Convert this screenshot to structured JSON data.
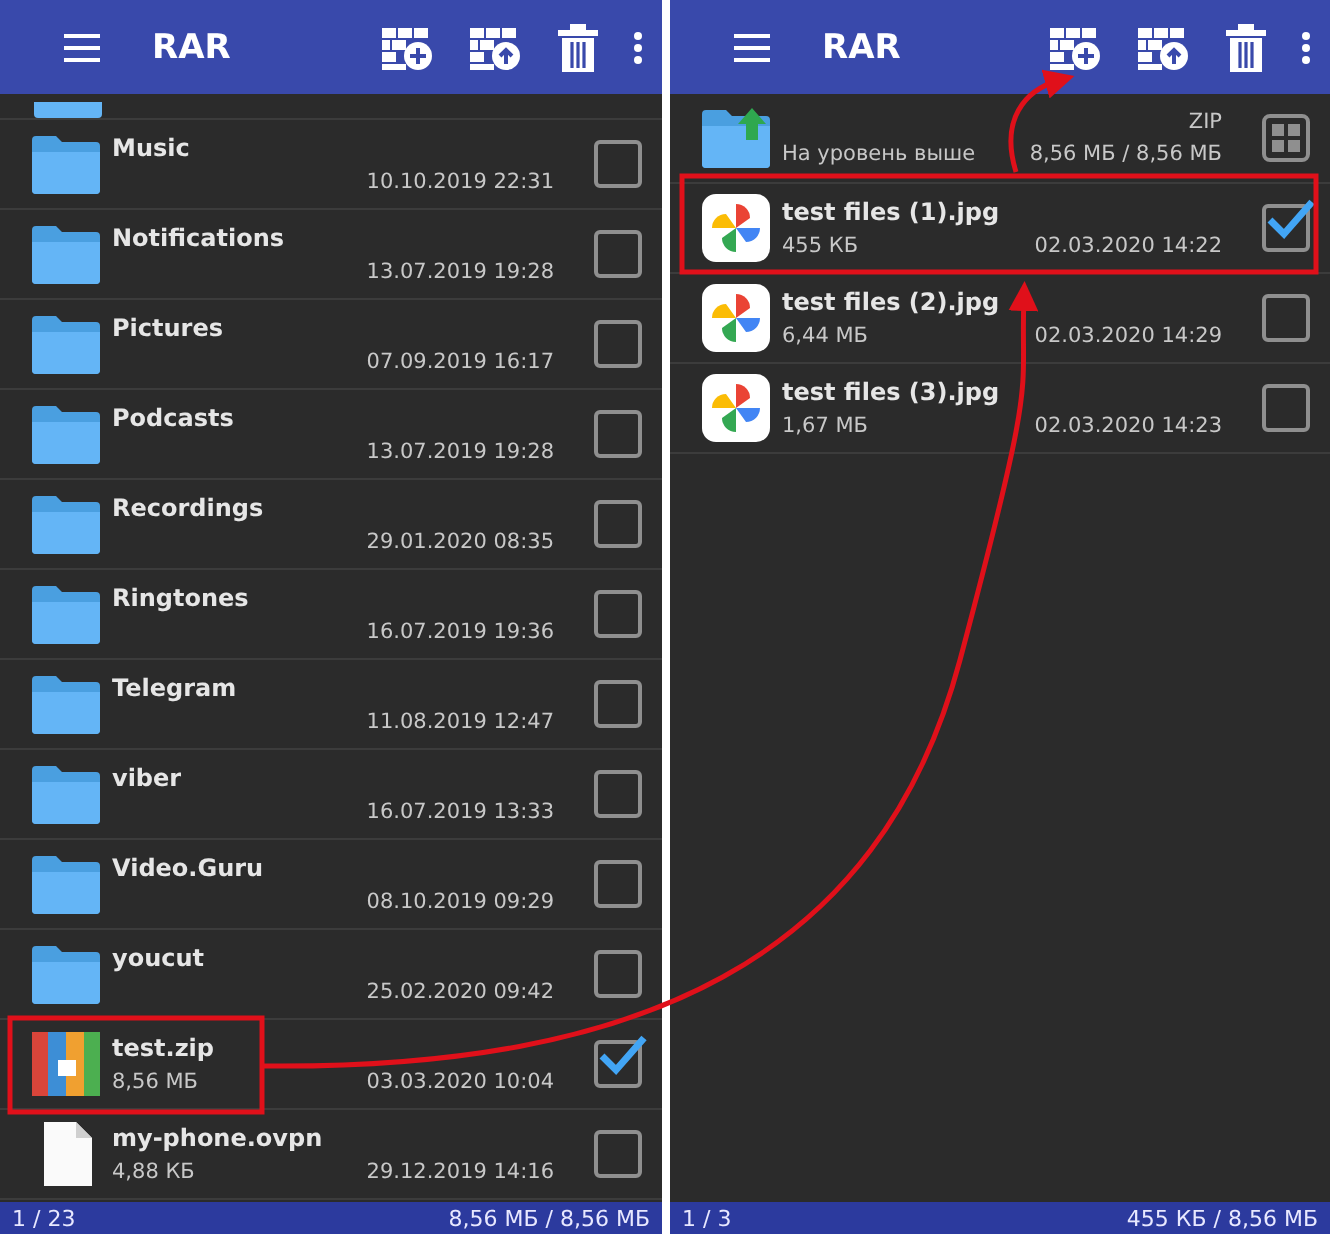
{
  "panels": [
    {
      "toolbar": {
        "title": "RAR"
      },
      "partial_row": true,
      "files": [
        {
          "kind": "folder",
          "name": "Music",
          "date": "10.10.2019 22:31",
          "checked": false
        },
        {
          "kind": "folder",
          "name": "Notifications",
          "date": "13.07.2019 19:28",
          "checked": false
        },
        {
          "kind": "folder",
          "name": "Pictures",
          "date": "07.09.2019 16:17",
          "checked": false
        },
        {
          "kind": "folder",
          "name": "Podcasts",
          "date": "13.07.2019 19:28",
          "checked": false
        },
        {
          "kind": "folder",
          "name": "Recordings",
          "date": "29.01.2020 08:35",
          "checked": false
        },
        {
          "kind": "folder",
          "name": "Ringtones",
          "date": "16.07.2019 19:36",
          "checked": false
        },
        {
          "kind": "folder",
          "name": "Telegram",
          "date": "11.08.2019 12:47",
          "checked": false
        },
        {
          "kind": "folder",
          "name": "viber",
          "date": "16.07.2019 13:33",
          "checked": false
        },
        {
          "kind": "folder",
          "name": "Video.Guru",
          "date": "08.10.2019 09:29",
          "checked": false
        },
        {
          "kind": "folder",
          "name": "youcut",
          "date": "25.02.2020 09:42",
          "checked": false
        },
        {
          "kind": "archive",
          "name": "test.zip",
          "size": "8,56 МБ",
          "date": "03.03.2020 10:04",
          "checked": true
        },
        {
          "kind": "document",
          "name": "my-phone.ovpn",
          "size": "4,88 КБ",
          "date": "29.12.2019 14:16",
          "checked": false
        }
      ],
      "status_bar": {
        "count": "1 / 23",
        "size": "8,56 МБ / 8,56 МБ"
      }
    },
    {
      "toolbar": {
        "title": "RAR"
      },
      "partial_row": false,
      "up_row": {
        "label": "На уровень выше",
        "type": "ZIP",
        "size": "8,56 МБ / 8,56 МБ"
      },
      "files": [
        {
          "kind": "image",
          "name": "test files (1).jpg",
          "size": "455 КБ",
          "date": "02.03.2020 14:22",
          "checked": true
        },
        {
          "kind": "image",
          "name": "test files (2).jpg",
          "size": "6,44 МБ",
          "date": "02.03.2020 14:29",
          "checked": false
        },
        {
          "kind": "image",
          "name": "test files (3).jpg",
          "size": "1,67 МБ",
          "date": "02.03.2020 14:23",
          "checked": false
        }
      ],
      "status_bar": {
        "count": "1 / 3",
        "size": "455 КБ / 8,56 МБ"
      }
    }
  ]
}
